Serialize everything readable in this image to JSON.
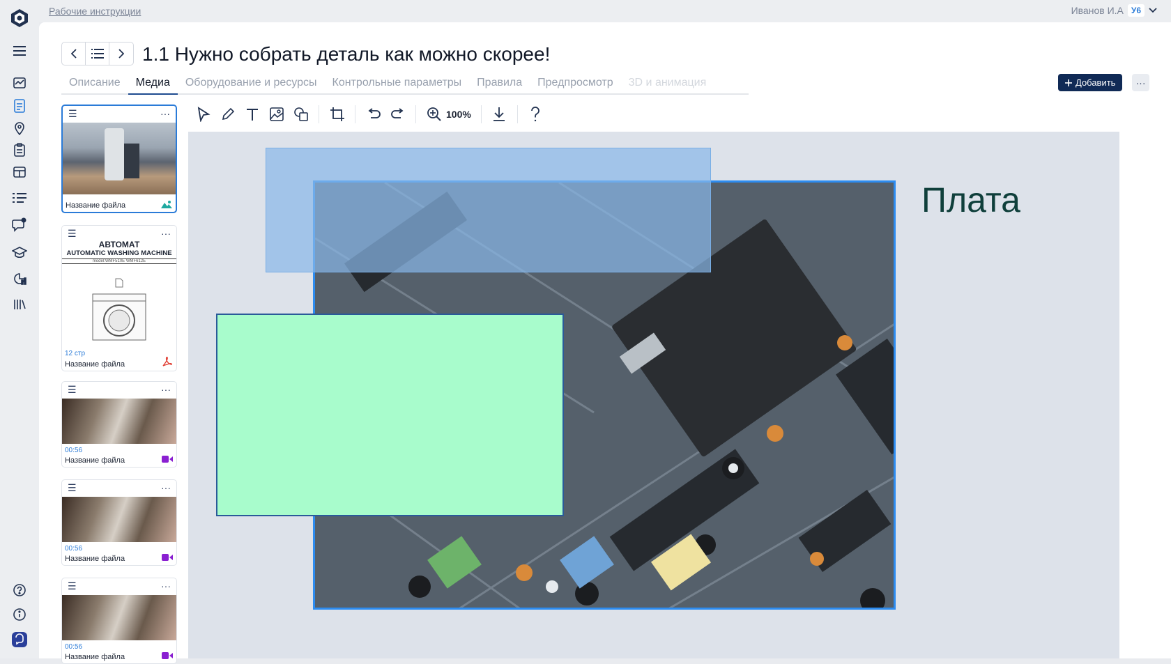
{
  "app": {
    "breadcrumb": "Рабочие инструкции"
  },
  "user": {
    "name": "Иванов И.А",
    "badge": "У6"
  },
  "page": {
    "title": "1.1 Нужно собрать деталь как можно скорее!"
  },
  "tabs": [
    {
      "label": "Описание"
    },
    {
      "label": "Медиа"
    },
    {
      "label": "Оборудование и ресурсы"
    },
    {
      "label": "Контрольные параметры"
    },
    {
      "label": "Правила"
    },
    {
      "label": "Предпросмотр"
    },
    {
      "label": "3D и анимация"
    }
  ],
  "actions": {
    "add_label": "Добавить",
    "more_label": "···"
  },
  "toolbar": {
    "zoom": "100%"
  },
  "thumbnails": [
    {
      "name": "Название файла",
      "type": "image"
    },
    {
      "name": "Название файла",
      "type": "pdf",
      "pages": "12 стр",
      "doc_title_line1": "АВТОМАТ",
      "doc_title_line2": "AUTOMATIC WASHING MACHINE",
      "doc_model": "model:WMF510E  WMF612E"
    },
    {
      "name": "Название файла",
      "type": "video",
      "duration": "00:56"
    },
    {
      "name": "Название файла",
      "type": "video",
      "duration": "00:56"
    },
    {
      "name": "Название файла",
      "type": "video",
      "duration": "00:56"
    }
  ],
  "canvas": {
    "text_label": "Плата"
  },
  "colors": {
    "accent": "#2a7bd8",
    "primary_button": "#102a56",
    "shape_blue": "#89b8e8",
    "shape_green": "#a8fccc",
    "label": "#0f3f3b"
  }
}
